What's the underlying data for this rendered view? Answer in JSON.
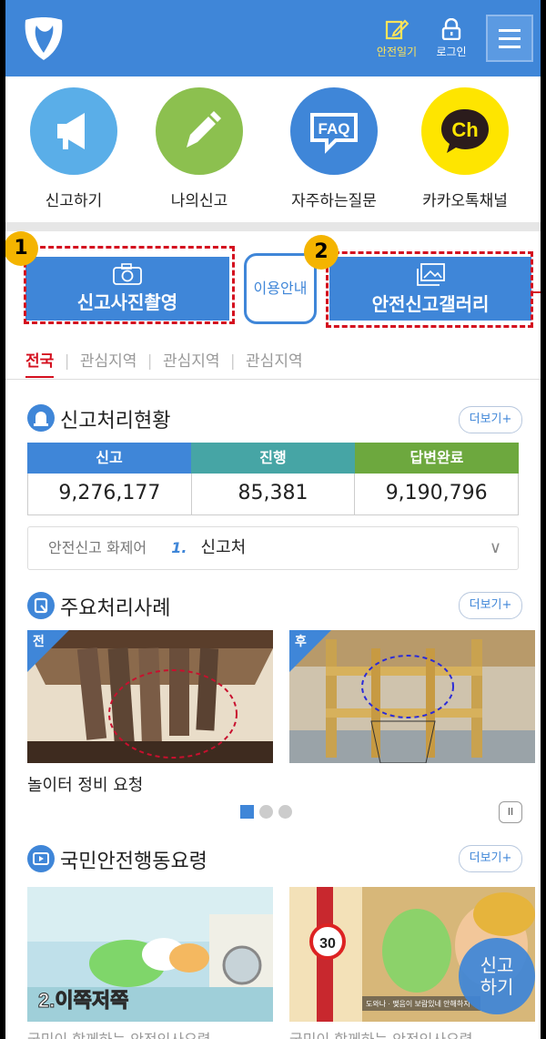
{
  "header": {
    "diary_label": "안전일기",
    "login_label": "로그인",
    "accent": "#3f86d8"
  },
  "quick_menu": [
    {
      "label": "신고하기",
      "icon": "megaphone-icon",
      "color": "#5aaee8"
    },
    {
      "label": "나의신고",
      "icon": "pencil-icon",
      "color": "#8cc04f"
    },
    {
      "label": "자주하는질문",
      "icon": "faq-icon",
      "color": "#3f86d8",
      "icon_text": "FAQ"
    },
    {
      "label": "카카오톡채널",
      "icon": "kakao-channel-icon",
      "color": "#fee500",
      "icon_text": "Ch"
    }
  ],
  "actions": {
    "photo_report": "신고사진촬영",
    "guide": "이용안내",
    "gallery": "안전신고갤러리",
    "marker_1": "1",
    "marker_2": "2"
  },
  "regions": {
    "tabs": [
      "전국",
      "관심지역",
      "관심지역",
      "관심지역"
    ],
    "separator": "|"
  },
  "status": {
    "title": "신고처리현황",
    "more": "더보기+",
    "headers": [
      "신고",
      "진행",
      "답변완료"
    ],
    "header_colors": [
      "#3f86d8",
      "#46a5a5",
      "#6da83e"
    ],
    "values": [
      "9,276,177",
      "85,381",
      "9,190,796"
    ]
  },
  "topic": {
    "label": "안전신고 화제어",
    "rank": "1.",
    "name": "신고처",
    "chevron": "∨"
  },
  "cases": {
    "title": "주요처리사례",
    "more": "더보기+",
    "before_tag": "전",
    "after_tag": "후",
    "caption": "놀이터 정비 요청",
    "pause": "II"
  },
  "guidelines": {
    "title": "국민안전행동요령",
    "more": "더보기+",
    "video1_text": "2.이쪽저쪽",
    "video2_badge": "30",
    "video2_sign": "도와나 · 맺음이 보람있네 안해하지",
    "cap1": "국민이 함께하는 안전인사요령",
    "cap2": "국민이 함께하는 안전인사요령"
  },
  "fab": {
    "line1": "신고",
    "line2": "하기"
  }
}
